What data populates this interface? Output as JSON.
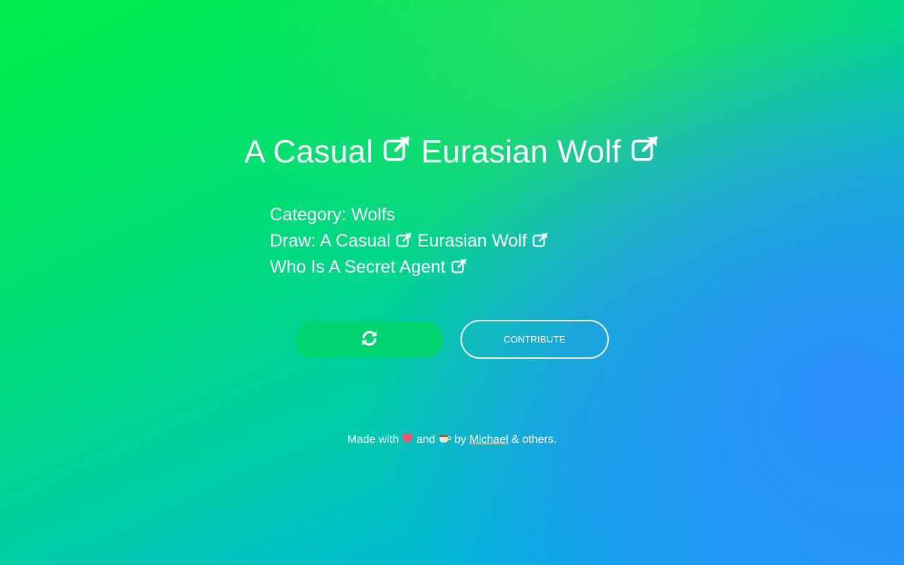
{
  "title": {
    "part1": "A Casual",
    "part2": "Eurasian Wolf"
  },
  "details": {
    "category_label": "Category:",
    "category_value": "Wolfs",
    "draw_label": "Draw:",
    "draw_part1": "A Casual",
    "draw_part2": "Eurasian Wolf",
    "who_text": "Who Is A Secret Agent"
  },
  "buttons": {
    "refresh_icon": "refresh-icon",
    "contribute_label": "CONTRIBUTE"
  },
  "footer": {
    "made_with": "Made with",
    "and": "and",
    "by": "by",
    "author": "Michael",
    "others": "& others.",
    "heart_icon": "heart-icon",
    "coffee_icon": "coffee-icon"
  },
  "colors": {
    "gradient_top_left": "#00ee4c",
    "gradient_bottom_right": "#2f8cff",
    "refresh_button": "#00d46e",
    "heart": "#ff4d6d"
  }
}
